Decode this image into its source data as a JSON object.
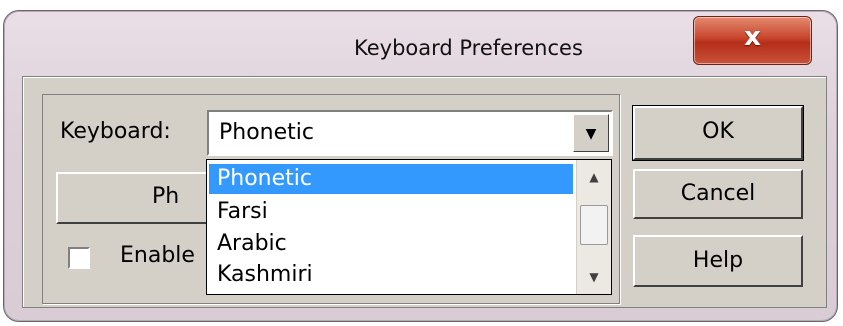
{
  "window": {
    "title": "Keyboard Preferences",
    "close_glyph": "x",
    "close_color": "#c8452c"
  },
  "keyboard_label": "Keyboard:",
  "keyboard_select": {
    "value": "Phonetic",
    "arrow": "▼",
    "options": [
      "Phonetic",
      "Farsi",
      "Arabic",
      "Kashmiri"
    ],
    "selected_index": 0,
    "selection_color": "#3399ff"
  },
  "scrollbar": {
    "up": "▲",
    "down": "▼"
  },
  "buttons": {
    "ok": "OK",
    "cancel": "Cancel",
    "help": "Help",
    "phonetic_partial": "Ph"
  },
  "enable_checkbox": {
    "label_partial": "Enable",
    "checked": false
  }
}
